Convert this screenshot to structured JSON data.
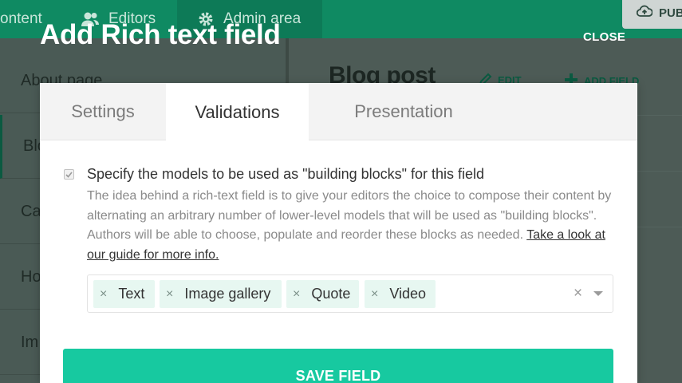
{
  "background": {
    "nav": {
      "item_content": "ontent",
      "item_editors": "Editors",
      "item_admin": "Admin area",
      "publish": "PUB"
    },
    "sidebar": {
      "items": [
        "About page",
        "Blo",
        "Ca",
        "Ho",
        "Im"
      ]
    },
    "main": {
      "title": "Blog post",
      "edit": "EDIT",
      "add_field": "ADD FIELD"
    }
  },
  "modal": {
    "title": "Add Rich text field",
    "close": "CLOSE",
    "tabs": [
      "Settings",
      "Validations",
      "Presentation"
    ],
    "active_tab": "Validations",
    "option": {
      "checked": true,
      "label": "Specify the models to be used as \"building blocks\" for this field",
      "help": "The idea behind a rich-text field is to give your editors the choice to compose their content by alternating an arbitrary number of lower-level models that will be used as \"building blocks\". Authors will be able to choose, populate and reorder these blocks as needed.",
      "help_link": "Take a look at our guide for more info."
    },
    "selected_models": [
      "Text",
      "Image gallery",
      "Quote",
      "Video"
    ],
    "tag_remove_glyph": "×",
    "clear_glyph": "×",
    "save": "SAVE FIELD"
  },
  "colors": {
    "accent": "#17c9a0",
    "nav_green": "#0f8a62",
    "tag_bg": "#e7f7f1"
  }
}
